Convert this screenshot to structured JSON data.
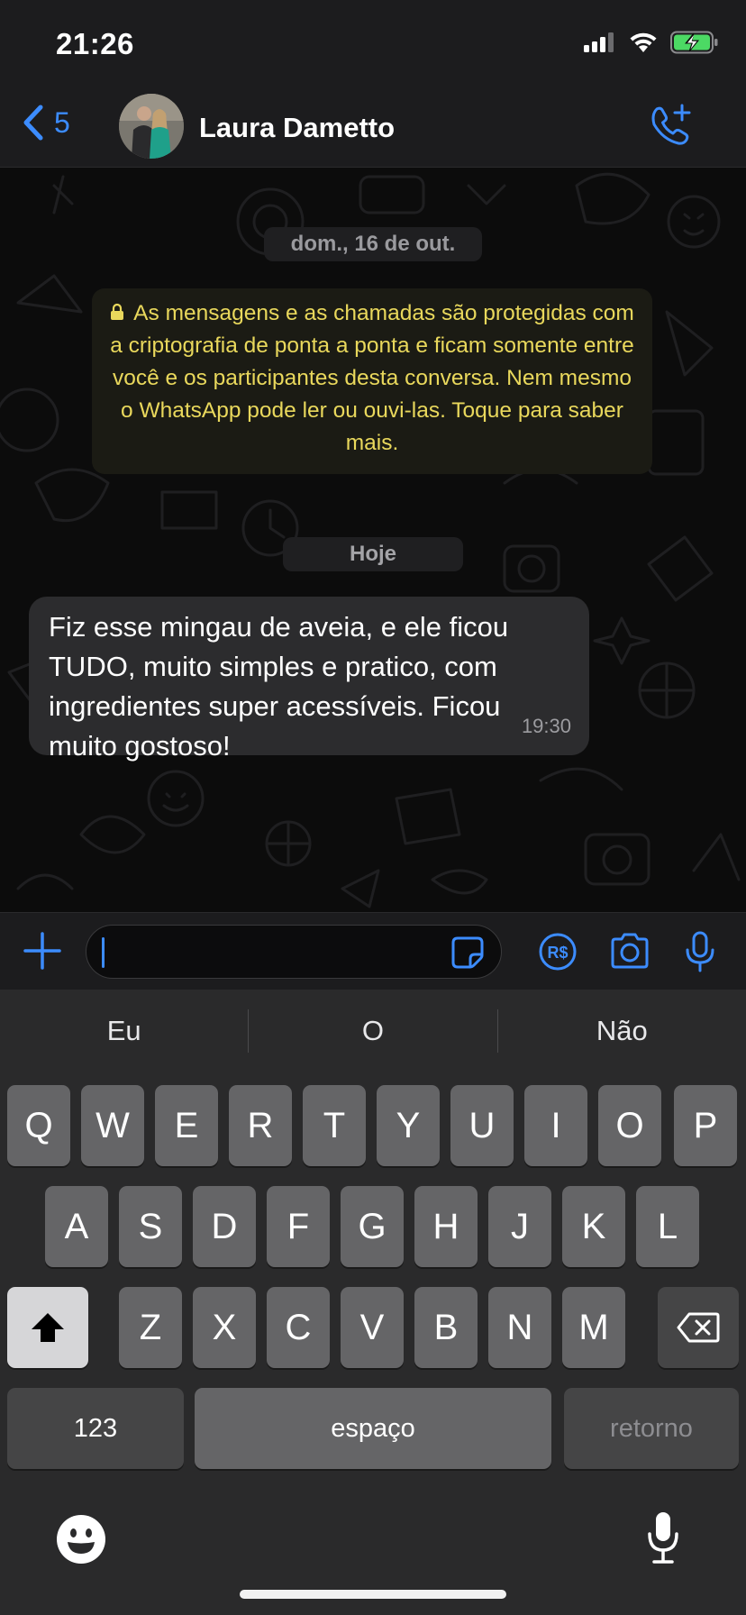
{
  "status_bar": {
    "time": "21:26",
    "battery_charging": true
  },
  "header": {
    "back_count": "5",
    "contact_name": "Laura Dametto",
    "icons": {
      "back": "chevron-left-icon",
      "call": "phone-plus-icon"
    }
  },
  "chat": {
    "date_label": "dom., 16 de out.",
    "encryption_notice": "As mensagens e as chamadas são protegidas com a criptografia de ponta a ponta e ficam somente entre você e os participantes desta conversa. Nem mesmo o WhatsApp pode ler ou ouvi-las. Toque para saber mais.",
    "today_label": "Hoje",
    "messages": [
      {
        "text": "Fiz esse mingau de aveia, e ele ficou TUDO, muito simples e pratico, com ingredientes super acessíveis. Ficou muito gostoso!",
        "time": "19:30",
        "direction": "incoming"
      }
    ]
  },
  "input_bar": {
    "value": "",
    "icons": [
      "plus-icon",
      "sticker-icon",
      "pix-money-icon",
      "camera-icon",
      "microphone-icon"
    ]
  },
  "keyboard": {
    "suggestions": [
      "Eu",
      "O",
      "Não"
    ],
    "row1": [
      "Q",
      "W",
      "E",
      "R",
      "T",
      "Y",
      "U",
      "I",
      "O",
      "P"
    ],
    "row2": [
      "A",
      "S",
      "D",
      "F",
      "G",
      "H",
      "J",
      "K",
      "L"
    ],
    "row3": [
      "Z",
      "X",
      "C",
      "V",
      "B",
      "N",
      "M"
    ],
    "numbers_key": "123",
    "space_key": "espaço",
    "return_key": "retorno"
  },
  "colors": {
    "accent": "#3c8cff",
    "notice_text": "#e9d85c",
    "bubble": "#2c2c2e"
  }
}
